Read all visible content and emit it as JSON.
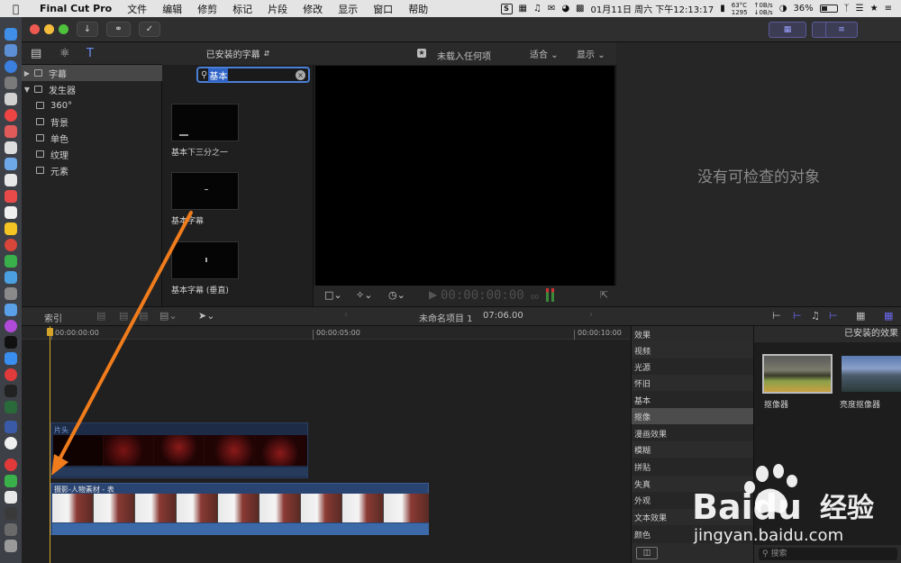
{
  "menubar": {
    "app_name": "Final Cut Pro",
    "menus": [
      "文件",
      "编辑",
      "修剪",
      "标记",
      "片段",
      "修改",
      "显示",
      "窗口",
      "帮助"
    ],
    "datetime": "01月11日 周六 下午12:13:17",
    "temp": "63°C",
    "fan": "1295",
    "net_up": "0B/s",
    "net_down": "0B/s",
    "battery": "36%"
  },
  "library": {
    "items": [
      {
        "label": "字幕",
        "expanded": false,
        "selected": true
      },
      {
        "label": "发生器",
        "expanded": true,
        "selected": false
      },
      {
        "label": "360°",
        "child": true
      },
      {
        "label": "背景",
        "child": true
      },
      {
        "label": "单色",
        "child": true
      },
      {
        "label": "纹理",
        "child": true
      },
      {
        "label": "元素",
        "child": true
      }
    ]
  },
  "browser": {
    "header": "已安装的字幕",
    "search_value": "基本",
    "thumbnails": [
      {
        "label": "基本下三分之一"
      },
      {
        "label": "基本字幕"
      },
      {
        "label": "基本字幕 (垂直)"
      }
    ]
  },
  "viewer": {
    "title": "未载入任何项",
    "fit": "适合",
    "view": "显示",
    "timecode": "00:00:00:00",
    "timecode_sub": "00"
  },
  "inspector": {
    "empty_text": "没有可检查的对象"
  },
  "timeline_bar": {
    "index_label": "索引",
    "project_name": "未命名项目 1",
    "duration": "07:06.00"
  },
  "timeline": {
    "ruler": [
      "00:00:00:00",
      "00:00:05:00",
      "00:00:10:00"
    ],
    "title_clip": "片头",
    "main_clip": "摄影-人物素材 - 表"
  },
  "effects": {
    "header": "效果",
    "categories": [
      "视频",
      "光源",
      "怀旧",
      "基本",
      "抠像",
      "漫画效果",
      "模糊",
      "拼贴",
      "失真",
      "外观",
      "文本效果",
      "颜色"
    ],
    "selected": "抠像",
    "panel_title": "已安装的效果",
    "items": [
      {
        "label": "抠像器"
      },
      {
        "label": "亮度抠像器"
      }
    ],
    "search_placeholder": "搜索"
  },
  "watermark": {
    "brand": "Baidu",
    "brand_cn": "经验",
    "url": "jingyan.baidu.com"
  },
  "colors": {
    "accent_blue": "#2f63c6",
    "playhead": "#d4a52a",
    "arrow": "#f07c1c"
  }
}
